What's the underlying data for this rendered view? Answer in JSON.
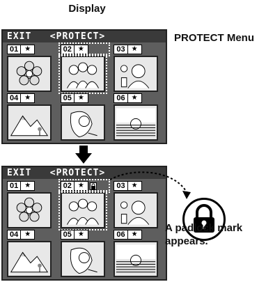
{
  "heading": "Display",
  "protect_menu_label": "PROTECT Menu",
  "screens": [
    {
      "title": "EXIT   <PROTECT>",
      "cells": [
        {
          "num": "01",
          "star": "★",
          "icon": "flower-icon"
        },
        {
          "num": "02",
          "star": "★",
          "icon": "group-people-icon",
          "selected": true
        },
        {
          "num": "03",
          "star": "★",
          "icon": "person-portrait-icon"
        },
        {
          "num": "04",
          "star": "★",
          "icon": "mountain-landscape-icon"
        },
        {
          "num": "05",
          "star": "★",
          "icon": "woman-portrait-icon"
        },
        {
          "num": "06",
          "star": "★",
          "icon": "sunset-icon"
        }
      ]
    },
    {
      "title": "EXIT   <PROTECT>",
      "cells": [
        {
          "num": "01",
          "star": "★",
          "icon": "flower-icon"
        },
        {
          "num": "02",
          "star": "★",
          "icon": "group-people-icon",
          "selected": true,
          "locked": true
        },
        {
          "num": "03",
          "star": "★",
          "icon": "person-portrait-icon"
        },
        {
          "num": "04",
          "star": "★",
          "icon": "mountain-landscape-icon"
        },
        {
          "num": "05",
          "star": "★",
          "icon": "woman-portrait-icon"
        },
        {
          "num": "06",
          "star": "★",
          "icon": "sunset-icon"
        }
      ]
    }
  ],
  "callout_lines": [
    "A padlock mark",
    "appears."
  ],
  "icons": {
    "arrow": "down-arrow-icon",
    "padlock": "padlock-icon"
  }
}
